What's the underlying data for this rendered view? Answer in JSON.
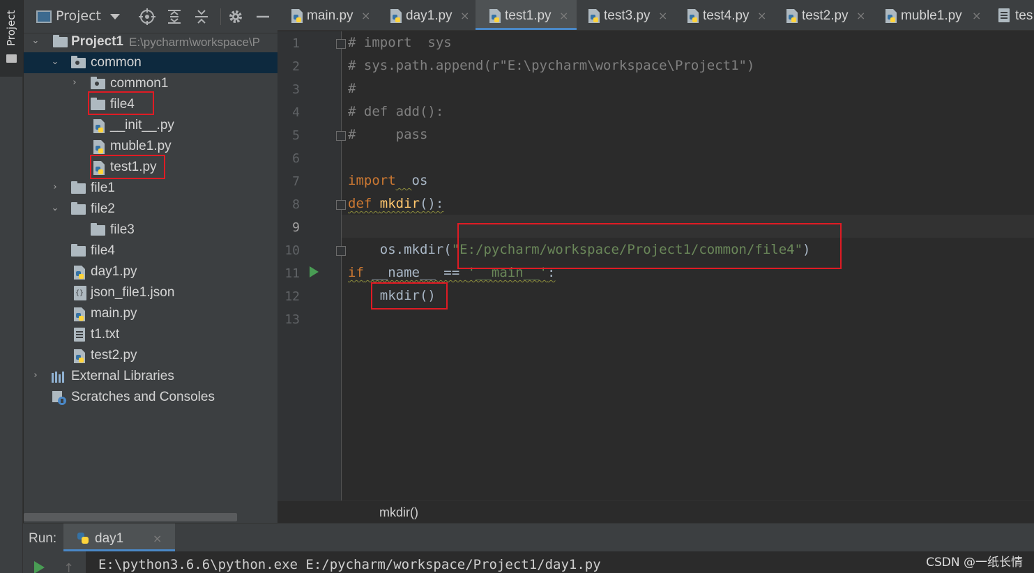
{
  "sidebar_strip": {
    "tab_label": "Project"
  },
  "project_panel": {
    "header": {
      "title": "Project"
    },
    "tree": [
      {
        "label": "Project1",
        "path": "E:\\pycharm\\workspace\\P",
        "type": "folder",
        "expanded": true
      },
      {
        "label": "common",
        "type": "package",
        "expanded": true,
        "selected": true
      },
      {
        "label": "common1",
        "type": "package",
        "expanded": false
      },
      {
        "label": "file4",
        "type": "folder",
        "highlighted": true
      },
      {
        "label": "__init__.py",
        "type": "python"
      },
      {
        "label": "muble1.py",
        "type": "python"
      },
      {
        "label": "test1.py",
        "type": "python",
        "highlighted": true
      },
      {
        "label": "file1",
        "type": "folder",
        "expanded": false
      },
      {
        "label": "file2",
        "type": "folder",
        "expanded": true
      },
      {
        "label": "file3",
        "type": "folder"
      },
      {
        "label": "file4",
        "type": "folder"
      },
      {
        "label": "day1.py",
        "type": "python"
      },
      {
        "label": "json_file1.json",
        "type": "json"
      },
      {
        "label": "main.py",
        "type": "python"
      },
      {
        "label": "t1.txt",
        "type": "text"
      },
      {
        "label": "test2.py",
        "type": "python"
      },
      {
        "label": "External Libraries",
        "type": "libraries",
        "expanded": false
      },
      {
        "label": "Scratches and Consoles",
        "type": "scratches"
      }
    ]
  },
  "editor_tabs": [
    {
      "label": "main.py",
      "active": false
    },
    {
      "label": "day1.py",
      "active": false
    },
    {
      "label": "test1.py",
      "active": true
    },
    {
      "label": "test3.py",
      "active": false
    },
    {
      "label": "test4.py",
      "active": false
    },
    {
      "label": "test2.py",
      "active": false
    },
    {
      "label": "muble1.py",
      "active": false
    },
    {
      "label": "tes",
      "active": false
    }
  ],
  "tab_close_glyph": "×",
  "editor": {
    "current_line": 9,
    "line_numbers": [
      "1",
      "2",
      "3",
      "4",
      "5",
      "6",
      "7",
      "8",
      "9",
      "10",
      "11",
      "12",
      "13"
    ],
    "lines": [
      [
        {
          "t": "# import  sys",
          "c": "comment"
        }
      ],
      [
        {
          "t": "# sys.path.append(r\"E:\\pycharm\\workspace\\Project1\")",
          "c": "comment"
        }
      ],
      [
        {
          "t": "#",
          "c": "comment"
        }
      ],
      [
        {
          "t": "# def add():",
          "c": "comment"
        }
      ],
      [
        {
          "t": "#     pass",
          "c": "comment"
        }
      ],
      [],
      [
        {
          "t": "import",
          "c": "kw"
        },
        {
          "t": "  ",
          "c": "default",
          "w": true
        },
        {
          "t": "os",
          "c": "default"
        }
      ],
      [
        {
          "t": "def",
          "c": "kw",
          "w": true
        },
        {
          "t": " ",
          "c": "default",
          "w": true
        },
        {
          "t": "mkdir",
          "c": "fn",
          "w": true
        },
        {
          "t": "():",
          "c": "default",
          "w": true
        }
      ],
      [],
      [
        {
          "t": "    os.mkdir(",
          "c": "default"
        },
        {
          "t": "\"E:/pycharm/workspace/Project1/common/file4\"",
          "c": "str"
        },
        {
          "t": ")",
          "c": "default"
        }
      ],
      [
        {
          "t": "if",
          "c": "kw",
          "w": true
        },
        {
          "t": " __name__ == ",
          "c": "default",
          "w": true
        },
        {
          "t": "'__main__'",
          "c": "str",
          "w": true
        },
        {
          "t": ":",
          "c": "default",
          "w": true
        }
      ],
      [
        {
          "t": "    mkdir()",
          "c": "default"
        }
      ],
      []
    ]
  },
  "breadcrumb": "mkdir()",
  "run_panel": {
    "label": "Run:",
    "tab": "day1",
    "console": "E:\\python3.6.6\\python.exe E:/pycharm/workspace/Project1/day1.py"
  },
  "watermark": "CSDN @一纸长情",
  "colors": {
    "accent": "#4a88c7",
    "highlight_box": "#e01b24",
    "keyword": "#cc7832",
    "function": "#ffc66d",
    "string": "#6a8759",
    "comment": "#808080"
  }
}
